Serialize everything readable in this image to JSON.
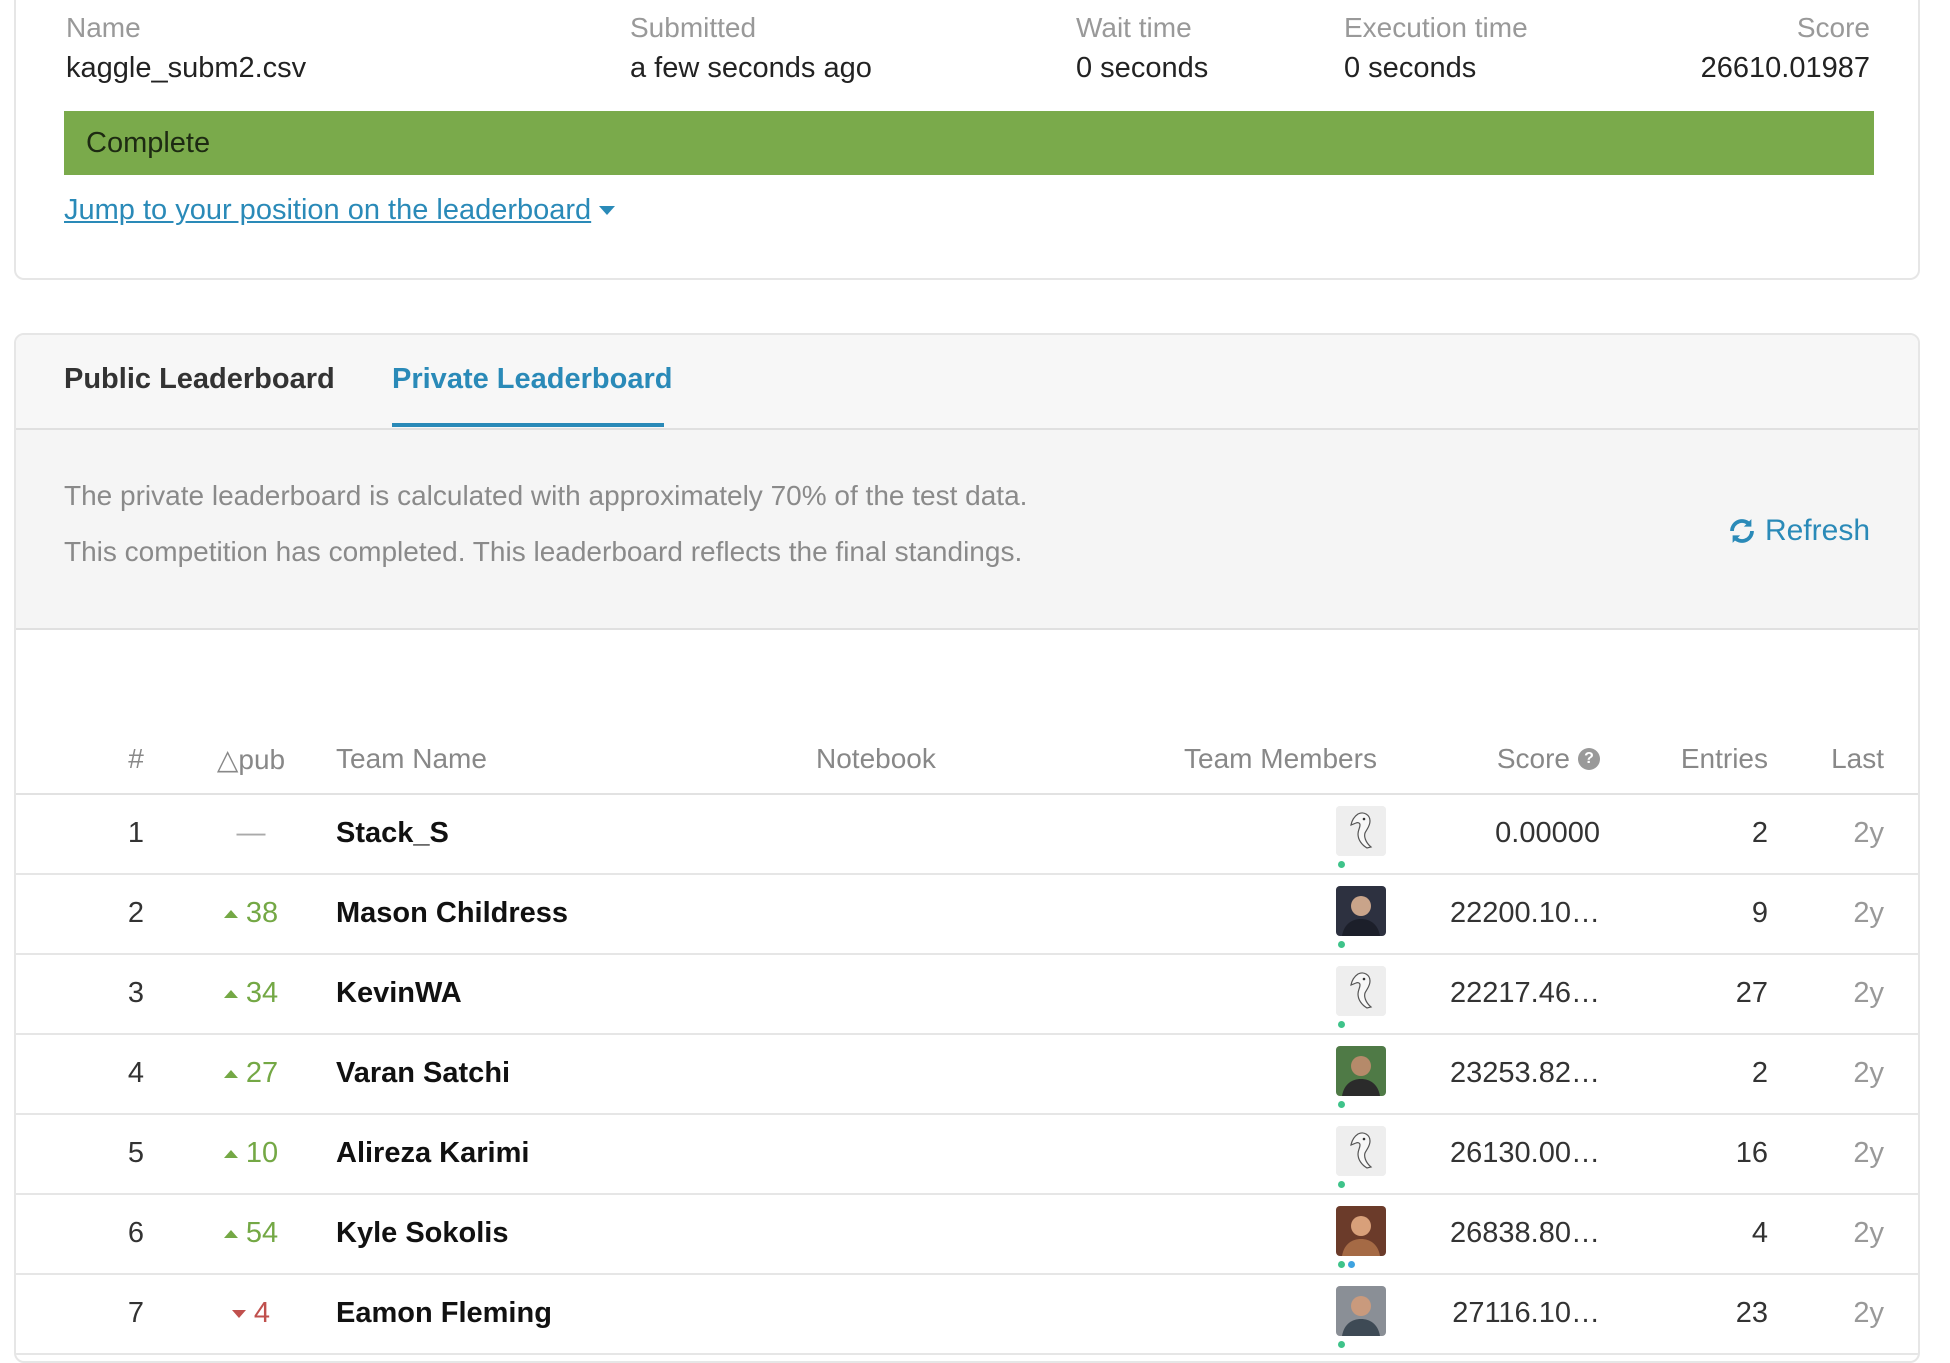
{
  "submission": {
    "headers": [
      "Name",
      "Submitted",
      "Wait time",
      "Execution time",
      "Score"
    ],
    "values": [
      "kaggle_subm2.csv",
      "a few seconds ago",
      "0 seconds",
      "0 seconds",
      "26610.01987"
    ],
    "status": "Complete",
    "status_color": "#7aaa4b",
    "jump_link": "Jump to your position on the leaderboard"
  },
  "tabs": [
    {
      "label": "Public Leaderboard",
      "active": false
    },
    {
      "label": "Private Leaderboard",
      "active": true
    }
  ],
  "info": {
    "line1": "The private leaderboard is calculated with approximately 70% of the test data.",
    "line2": "This competition has completed. This leaderboard reflects the final standings.",
    "refresh_label": "Refresh"
  },
  "table": {
    "headers": {
      "rank": "#",
      "delta": "△pub",
      "team": "Team Name",
      "notebook": "Notebook",
      "members": "Team Members",
      "score": "Score",
      "entries": "Entries",
      "last": "Last"
    },
    "rows": [
      {
        "rank": "1",
        "delta": "—",
        "direction": "none",
        "team": "Stack_S",
        "avatar": "goose-avatar",
        "score": "0.00000",
        "entries": "2",
        "last": "2y"
      },
      {
        "rank": "2",
        "delta": "38",
        "direction": "up",
        "team": "Mason Childress",
        "avatar": "photo-avatar",
        "score": "22200.10…",
        "entries": "9",
        "last": "2y"
      },
      {
        "rank": "3",
        "delta": "34",
        "direction": "up",
        "team": "KevinWA",
        "avatar": "goose-avatar",
        "score": "22217.46…",
        "entries": "27",
        "last": "2y"
      },
      {
        "rank": "4",
        "delta": "27",
        "direction": "up",
        "team": "Varan Satchi",
        "avatar": "photo-avatar",
        "score": "23253.82…",
        "entries": "2",
        "last": "2y"
      },
      {
        "rank": "5",
        "delta": "10",
        "direction": "up",
        "team": "Alireza Karimi",
        "avatar": "goose-avatar",
        "score": "26130.00…",
        "entries": "16",
        "last": "2y"
      },
      {
        "rank": "6",
        "delta": "54",
        "direction": "up",
        "team": "Kyle Sokolis",
        "avatar": "photo-avatar",
        "score": "26838.80…",
        "entries": "4",
        "last": "2y"
      },
      {
        "rank": "7",
        "delta": "4",
        "direction": "down",
        "team": "Eamon Fleming",
        "avatar": "photo-avatar",
        "score": "27116.10…",
        "entries": "23",
        "last": "2y"
      }
    ]
  }
}
